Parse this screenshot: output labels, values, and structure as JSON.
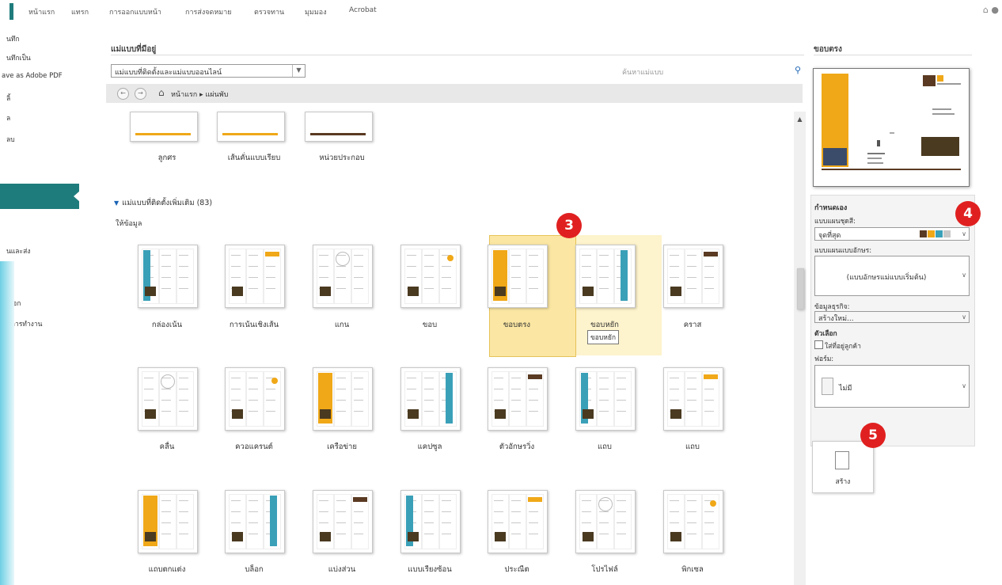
{
  "ribbon": {
    "tabs": [
      "หน้าแรก",
      "แทรก",
      "การออกแบบหน้า",
      "การส่งจดหมาย",
      "ตรวจทาน",
      "มุมมอง",
      "Acrobat"
    ],
    "right_icons": [
      "minimize-icon",
      "help-icon"
    ]
  },
  "leftnav": {
    "items": [
      "นทึก",
      "นทึกเป็น",
      "ave as Adobe PDF",
      "ลิ้",
      "ล",
      "ลบ",
      "",
      "นและส่ง",
      "เลือก",
      "นการทำงาน"
    ]
  },
  "main": {
    "heading": "แม่แบบที่มีอยู่",
    "dropdown_value": "แม่แบบที่ติดตั้งและแม่แบบออนไลน์",
    "search_placeholder": "ค้นหาแม่แบบ",
    "breadcrumb": "หน้าแรก ▸ แผ่นพับ",
    "section_title": "แม่แบบที่ติดตั้งเพิ่มเติม (83)",
    "subsection": "ให้ข้อมูล",
    "top_row": [
      "ลูกศร",
      "เส้นคั่นแบบเรียบ",
      "หน่วยประกอบ"
    ],
    "rows": [
      [
        "กล่องเน้น",
        "การเน้นเชิงเส้น",
        "แกน",
        "ขอบ",
        "ขอบตรง",
        "ขอบหยัก",
        "คราส"
      ],
      [
        "คลื่น",
        "ควอแครนต์",
        "เครือข่าย",
        "แคปซูล",
        "ตัวอักษรวิ่ง",
        "แถบ",
        "แถบ"
      ],
      [
        "แถบตกแต่ง",
        "บล็อก",
        "แบ่งส่วน",
        "แบบเรียงซ้อน",
        "ประณีต",
        "โปรไฟล์",
        "พิกเซล"
      ]
    ],
    "tooltip": "ขอบหยัก",
    "badges": [
      "3",
      "4",
      "5"
    ]
  },
  "right": {
    "title": "ขอบตรง",
    "customize_title": "กำหนดเอง",
    "color_scheme_label": "แบบแผนชุดสี:",
    "color_scheme_value": "จุดที่สุด",
    "font_scheme_label": "แบบแผนแบบอักษร:",
    "font_scheme_value": "(แบบอักษรแม่แบบเริ่มต้น)",
    "business_info_label": "ข้อมูลธุรกิจ:",
    "business_info_value": "สร้างใหม่...",
    "options_label": "ตัวเลือก",
    "checkbox_label": "ใส่ที่อยู่ลูกค้า",
    "form_label": "ฟอร์ม:",
    "form_value": "ไม่มี",
    "create_label": "สร้าง",
    "swatch_colors": [
      "#5a3a22",
      "#f0a818",
      "#3aa0b8",
      "#c8c8c8"
    ]
  }
}
